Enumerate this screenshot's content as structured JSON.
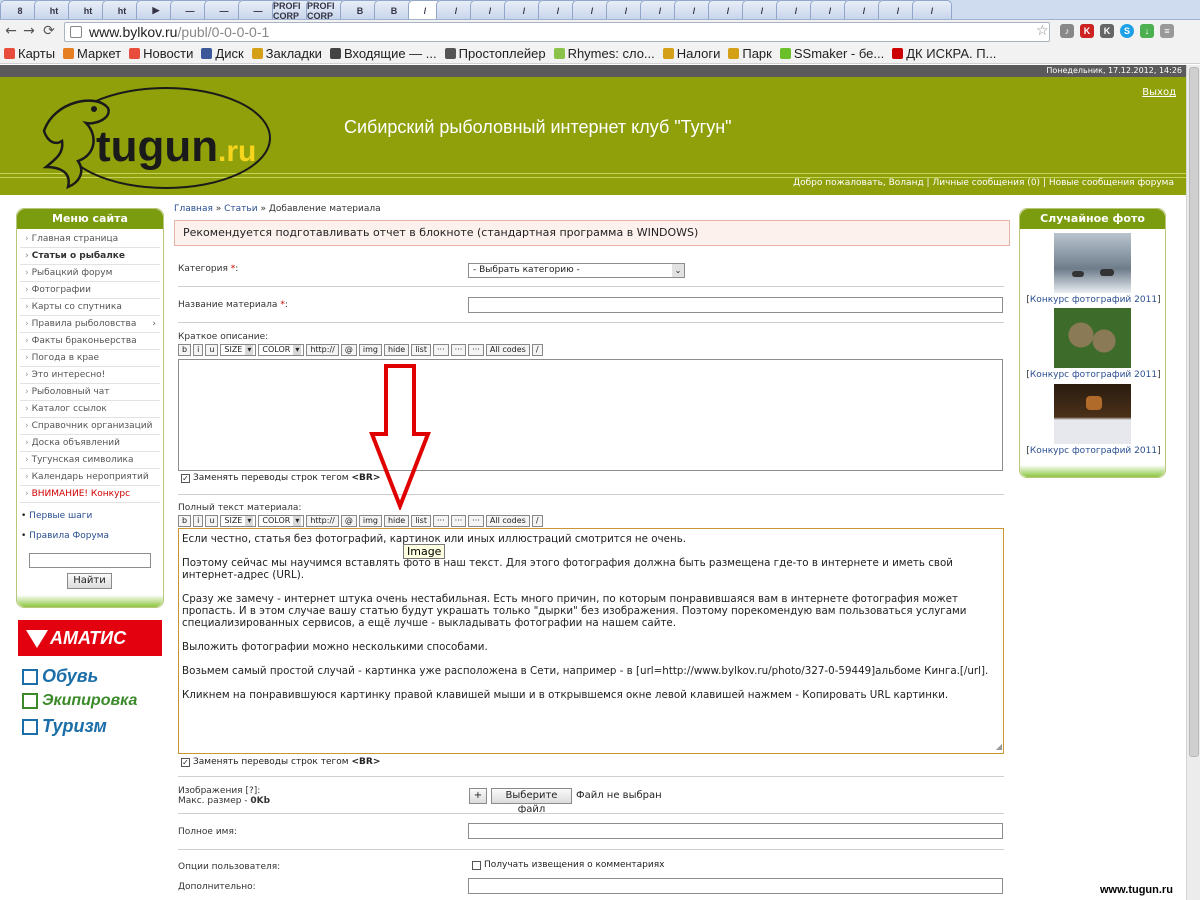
{
  "browser": {
    "tabs": [
      "8",
      "ht",
      "ht",
      "ht",
      "▶",
      "—",
      "—",
      "—",
      "PROFI CORP",
      "PROFI CORP",
      "B",
      "B",
      "/",
      "/",
      "/",
      "/",
      "/",
      "/",
      "/",
      "/",
      "/",
      "/",
      "/",
      "/",
      "/",
      "/",
      "/",
      "/"
    ],
    "url_host": "www.bylkov.ru",
    "url_path": "/publ/0-0-0-0-1",
    "bookmarks": [
      "Карты",
      "Маркет",
      "Новости",
      "Диск",
      "Закладки",
      "Входящие — ...",
      "Простоплейер",
      "Rhymes: сло...",
      "Налоги",
      "Парк",
      "SSmaker - бе...",
      "ДК ИСКРА. П..."
    ]
  },
  "site": {
    "datetime": "Понедельник, 17.12.2012, 14:26",
    "logo_text": "tugun",
    "logo_ru": ".ru",
    "title": "Сибирский рыболовный интернет клуб \"Тугун\"",
    "logout": "Выход",
    "welcome_prefix": "Добро пожаловать,",
    "user": "Воланд",
    "messages": "Личные сообщения (0)",
    "forum_new": "Новые сообщения форума"
  },
  "left_menu": {
    "title": "Меню сайта",
    "items": [
      "Главная страница",
      "Статьи о рыбалке",
      "Рыбацкий форум",
      "Фотографии",
      "Карты со спутника",
      "Правила рыболовства",
      "Факты браконьерства",
      "Погода в крае",
      "Это интересно!",
      "Рыболовный чат",
      "Каталог ссылок",
      "Справочник организаций",
      "Доска объявлений",
      "Тугунская символика",
      "Календарь нероприятий",
      "ВНИМАНИЕ! Конкурс"
    ],
    "first_steps": "Первые шаги",
    "forum_rules": "Правила Форума",
    "search_button": "Найти"
  },
  "ads": {
    "brand": "АМАТИС",
    "lines": [
      "Обувь",
      "Экипировка",
      "Туризм"
    ]
  },
  "breadcrumb": {
    "home": "Главная",
    "section": "Статьи",
    "current": "Добавление материала",
    "sep": "»"
  },
  "notice": "Рекомендуется подготавливать отчет в блокноте (стандартная программа в WINDOWS)",
  "form": {
    "category_label": "Категория",
    "category_value": "- Выбрать категорию -",
    "name_label": "Название материала",
    "short_label": "Краткое описание:",
    "full_label": "Полный текст материала:",
    "bb_buttons": [
      "b",
      "i",
      "u"
    ],
    "bb_size": "SIZE",
    "bb_color": "COLOR",
    "bb_buttons2": [
      "http://",
      "@",
      "img",
      "hide",
      "list",
      "···",
      "···",
      "···",
      "All codes",
      "/"
    ],
    "replace_br": "Заменять переводы строк тегом",
    "br_tag": "<BR>",
    "tooltip": "Image",
    "full_text": [
      "Если честно, статья без фотографий, картинок или иных иллюстраций смотрится не очень.",
      "Поэтому сейчас мы научимся вставлять фото в наш текст. Для этого фотография должна быть размещена где-то в интернете и иметь свой интернет-адрес (URL).",
      "Сразу же замечу - интернет штука очень нестабильная. Есть много причин, по которым понравившаяся вам в интернете фотография может пропасть. И в этом случае вашу статью будут украшать только \"дырки\" без изображения. Поэтому порекомендую вам пользоваться услугами специализированных сервисов, а ещё лучше - выкладывать фотографии на нашем сайте.",
      "Выложить фотографии можно несколькими способами.",
      "Возьмем самый простой случай - картинка уже расположена в Сети, например - в [url=http://www.bylkov.ru/photo/327-0-59449]альбоме Кинга.[/url].",
      "Кликнем на понравившуюся картинку правой клавишей мыши и в открывшемся окне левой клавишей нажмем - Копировать URL картинки."
    ],
    "images_label": "Изображения [?]:",
    "max_size": "Макс. размер - ",
    "max_size_val": "0Kb",
    "plus": "+",
    "choose_file": "Выберите файл",
    "no_file": "Файл не выбран",
    "fullname_label": "Полное имя:",
    "options_label": "Опции пользователя:",
    "notify": "Получать извещения о комментариях",
    "extra_label": "Дополнительно:"
  },
  "random_photo": {
    "title": "Случайное фото",
    "caption": "Конкурс фотографий 2011",
    "photos": [
      "night-snow",
      "pine-cones",
      "dog-in-snow"
    ]
  },
  "watermark": "www.tugun.ru",
  "colors": {
    "header_green": "#8fa00b",
    "menu_green": "#7c9c10",
    "accent_red": "#d00000"
  }
}
